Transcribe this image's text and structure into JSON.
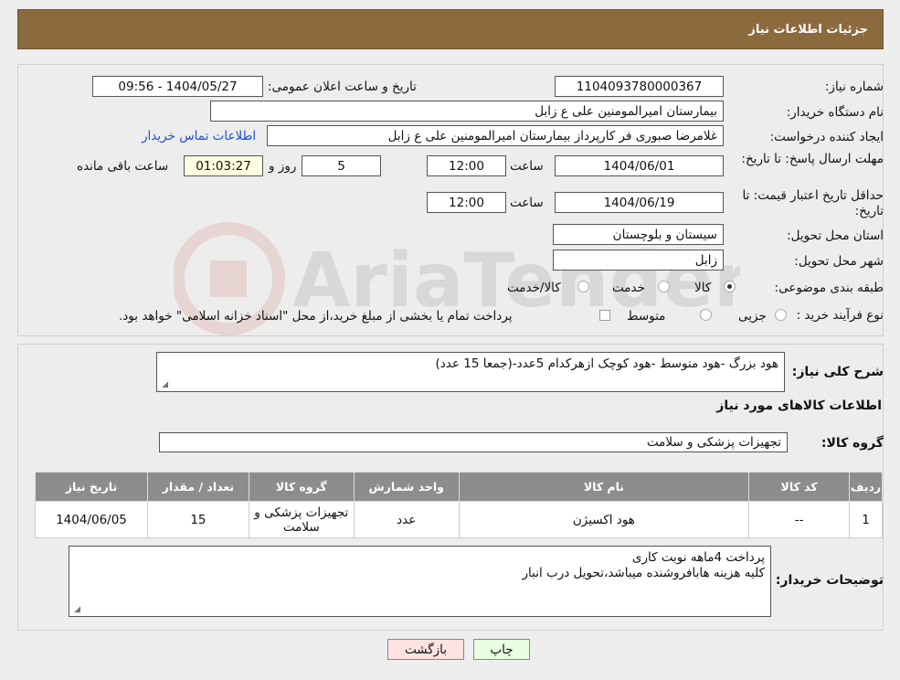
{
  "header": {
    "title": "جزئیات اطلاعات نیاز"
  },
  "fields": {
    "need_number_label": "شماره نیاز:",
    "need_number": "1104093780000367",
    "announce_label": "تاریخ و ساعت اعلان عمومی:",
    "announce_value": "1404/05/27 - 09:56",
    "buyer_label": "نام دستگاه خریدار:",
    "buyer_value": "بیمارستان امیرالمومنین علی  ع  زابل",
    "creator_label": "ایجاد کننده درخواست:",
    "creator_value": "غلامرضا صبوری فر کارپرداز بیمارستان امیرالمومنین علی  ع  زابل",
    "contact_link": "اطلاعات تماس خریدار",
    "deadline_label": "مهلت ارسال پاسخ: تا تاریخ:",
    "deadline_date": "1404/06/01",
    "time_label": "ساعت",
    "deadline_time": "12:00",
    "days_value": "5",
    "days_label": "روز و",
    "remaining_time": "01:03:27",
    "remaining_label": "ساعت باقی مانده",
    "validity_label": "حداقل تاریخ اعتبار قیمت: تا تاریخ:",
    "validity_date": "1404/06/19",
    "validity_time": "12:00",
    "province_label": "استان محل تحویل:",
    "province_value": "سیستان و بلوچستان",
    "city_label": "شهر محل تحویل:",
    "city_value": "زابل",
    "category_label": "طبقه بندی موضوعی:",
    "category_options": [
      "کالا",
      "خدمت",
      "کالا/خدمت"
    ],
    "category_selected": "کالا",
    "process_label": "نوع فرآیند خرید :",
    "process_options": [
      "جزیی",
      "متوسط"
    ],
    "process_note": "پرداخت تمام یا بخشی از مبلغ خرید،از محل \"اسناد خزانه اسلامی\" خواهد بود."
  },
  "description": {
    "label": "شرح کلی نیاز:",
    "value": "هود بزرگ -هود متوسط -هود کوچک ازهرکدام 5عدد-(جمعا 15 عدد)"
  },
  "goods_info_title": "اطلاعات کالاهای مورد نیاز",
  "goods_group": {
    "label": "گروه کالا:",
    "value": "تجهیزات پزشکی و سلامت"
  },
  "table": {
    "headers": [
      "ردیف",
      "کد کالا",
      "نام کالا",
      "واحد شمارش",
      "گروه کالا",
      "تعداد / مقدار",
      "تاریخ نیاز"
    ],
    "rows": [
      [
        "1",
        "--",
        "هود اکسیژن",
        "عدد",
        "تجهیزات پزشکی و سلامت",
        "15",
        "1404/06/05"
      ]
    ]
  },
  "buyer_notes": {
    "label": "توضیحات خریدار:",
    "line1": "پرداخت 4ماهه نوبت کاری",
    "line2": "کلیه هزینه هابافروشنده میباشد،تحویل درب انبار"
  },
  "buttons": {
    "print": "چاپ",
    "back": "بازگشت"
  },
  "colors": {
    "header": "#8b6a3e",
    "print_btn": "#e9ffe0",
    "back_btn": "#ffe3e3"
  }
}
